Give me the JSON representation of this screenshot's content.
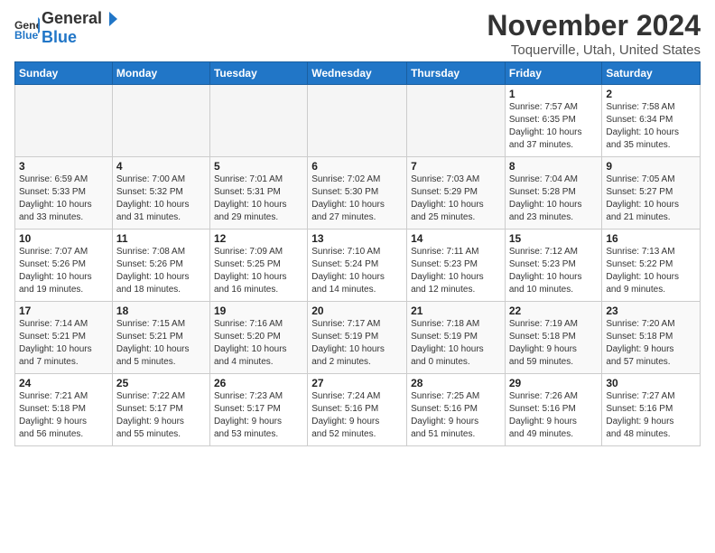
{
  "header": {
    "logo_general": "General",
    "logo_blue": "Blue",
    "month_year": "November 2024",
    "location": "Toquerville, Utah, United States"
  },
  "days_of_week": [
    "Sunday",
    "Monday",
    "Tuesday",
    "Wednesday",
    "Thursday",
    "Friday",
    "Saturday"
  ],
  "weeks": [
    [
      {
        "day": "",
        "info": ""
      },
      {
        "day": "",
        "info": ""
      },
      {
        "day": "",
        "info": ""
      },
      {
        "day": "",
        "info": ""
      },
      {
        "day": "",
        "info": ""
      },
      {
        "day": "1",
        "info": "Sunrise: 7:57 AM\nSunset: 6:35 PM\nDaylight: 10 hours\nand 37 minutes."
      },
      {
        "day": "2",
        "info": "Sunrise: 7:58 AM\nSunset: 6:34 PM\nDaylight: 10 hours\nand 35 minutes."
      }
    ],
    [
      {
        "day": "3",
        "info": "Sunrise: 6:59 AM\nSunset: 5:33 PM\nDaylight: 10 hours\nand 33 minutes."
      },
      {
        "day": "4",
        "info": "Sunrise: 7:00 AM\nSunset: 5:32 PM\nDaylight: 10 hours\nand 31 minutes."
      },
      {
        "day": "5",
        "info": "Sunrise: 7:01 AM\nSunset: 5:31 PM\nDaylight: 10 hours\nand 29 minutes."
      },
      {
        "day": "6",
        "info": "Sunrise: 7:02 AM\nSunset: 5:30 PM\nDaylight: 10 hours\nand 27 minutes."
      },
      {
        "day": "7",
        "info": "Sunrise: 7:03 AM\nSunset: 5:29 PM\nDaylight: 10 hours\nand 25 minutes."
      },
      {
        "day": "8",
        "info": "Sunrise: 7:04 AM\nSunset: 5:28 PM\nDaylight: 10 hours\nand 23 minutes."
      },
      {
        "day": "9",
        "info": "Sunrise: 7:05 AM\nSunset: 5:27 PM\nDaylight: 10 hours\nand 21 minutes."
      }
    ],
    [
      {
        "day": "10",
        "info": "Sunrise: 7:07 AM\nSunset: 5:26 PM\nDaylight: 10 hours\nand 19 minutes."
      },
      {
        "day": "11",
        "info": "Sunrise: 7:08 AM\nSunset: 5:26 PM\nDaylight: 10 hours\nand 18 minutes."
      },
      {
        "day": "12",
        "info": "Sunrise: 7:09 AM\nSunset: 5:25 PM\nDaylight: 10 hours\nand 16 minutes."
      },
      {
        "day": "13",
        "info": "Sunrise: 7:10 AM\nSunset: 5:24 PM\nDaylight: 10 hours\nand 14 minutes."
      },
      {
        "day": "14",
        "info": "Sunrise: 7:11 AM\nSunset: 5:23 PM\nDaylight: 10 hours\nand 12 minutes."
      },
      {
        "day": "15",
        "info": "Sunrise: 7:12 AM\nSunset: 5:23 PM\nDaylight: 10 hours\nand 10 minutes."
      },
      {
        "day": "16",
        "info": "Sunrise: 7:13 AM\nSunset: 5:22 PM\nDaylight: 10 hours\nand 9 minutes."
      }
    ],
    [
      {
        "day": "17",
        "info": "Sunrise: 7:14 AM\nSunset: 5:21 PM\nDaylight: 10 hours\nand 7 minutes."
      },
      {
        "day": "18",
        "info": "Sunrise: 7:15 AM\nSunset: 5:21 PM\nDaylight: 10 hours\nand 5 minutes."
      },
      {
        "day": "19",
        "info": "Sunrise: 7:16 AM\nSunset: 5:20 PM\nDaylight: 10 hours\nand 4 minutes."
      },
      {
        "day": "20",
        "info": "Sunrise: 7:17 AM\nSunset: 5:19 PM\nDaylight: 10 hours\nand 2 minutes."
      },
      {
        "day": "21",
        "info": "Sunrise: 7:18 AM\nSunset: 5:19 PM\nDaylight: 10 hours\nand 0 minutes."
      },
      {
        "day": "22",
        "info": "Sunrise: 7:19 AM\nSunset: 5:18 PM\nDaylight: 9 hours\nand 59 minutes."
      },
      {
        "day": "23",
        "info": "Sunrise: 7:20 AM\nSunset: 5:18 PM\nDaylight: 9 hours\nand 57 minutes."
      }
    ],
    [
      {
        "day": "24",
        "info": "Sunrise: 7:21 AM\nSunset: 5:18 PM\nDaylight: 9 hours\nand 56 minutes."
      },
      {
        "day": "25",
        "info": "Sunrise: 7:22 AM\nSunset: 5:17 PM\nDaylight: 9 hours\nand 55 minutes."
      },
      {
        "day": "26",
        "info": "Sunrise: 7:23 AM\nSunset: 5:17 PM\nDaylight: 9 hours\nand 53 minutes."
      },
      {
        "day": "27",
        "info": "Sunrise: 7:24 AM\nSunset: 5:16 PM\nDaylight: 9 hours\nand 52 minutes."
      },
      {
        "day": "28",
        "info": "Sunrise: 7:25 AM\nSunset: 5:16 PM\nDaylight: 9 hours\nand 51 minutes."
      },
      {
        "day": "29",
        "info": "Sunrise: 7:26 AM\nSunset: 5:16 PM\nDaylight: 9 hours\nand 49 minutes."
      },
      {
        "day": "30",
        "info": "Sunrise: 7:27 AM\nSunset: 5:16 PM\nDaylight: 9 hours\nand 48 minutes."
      }
    ]
  ]
}
